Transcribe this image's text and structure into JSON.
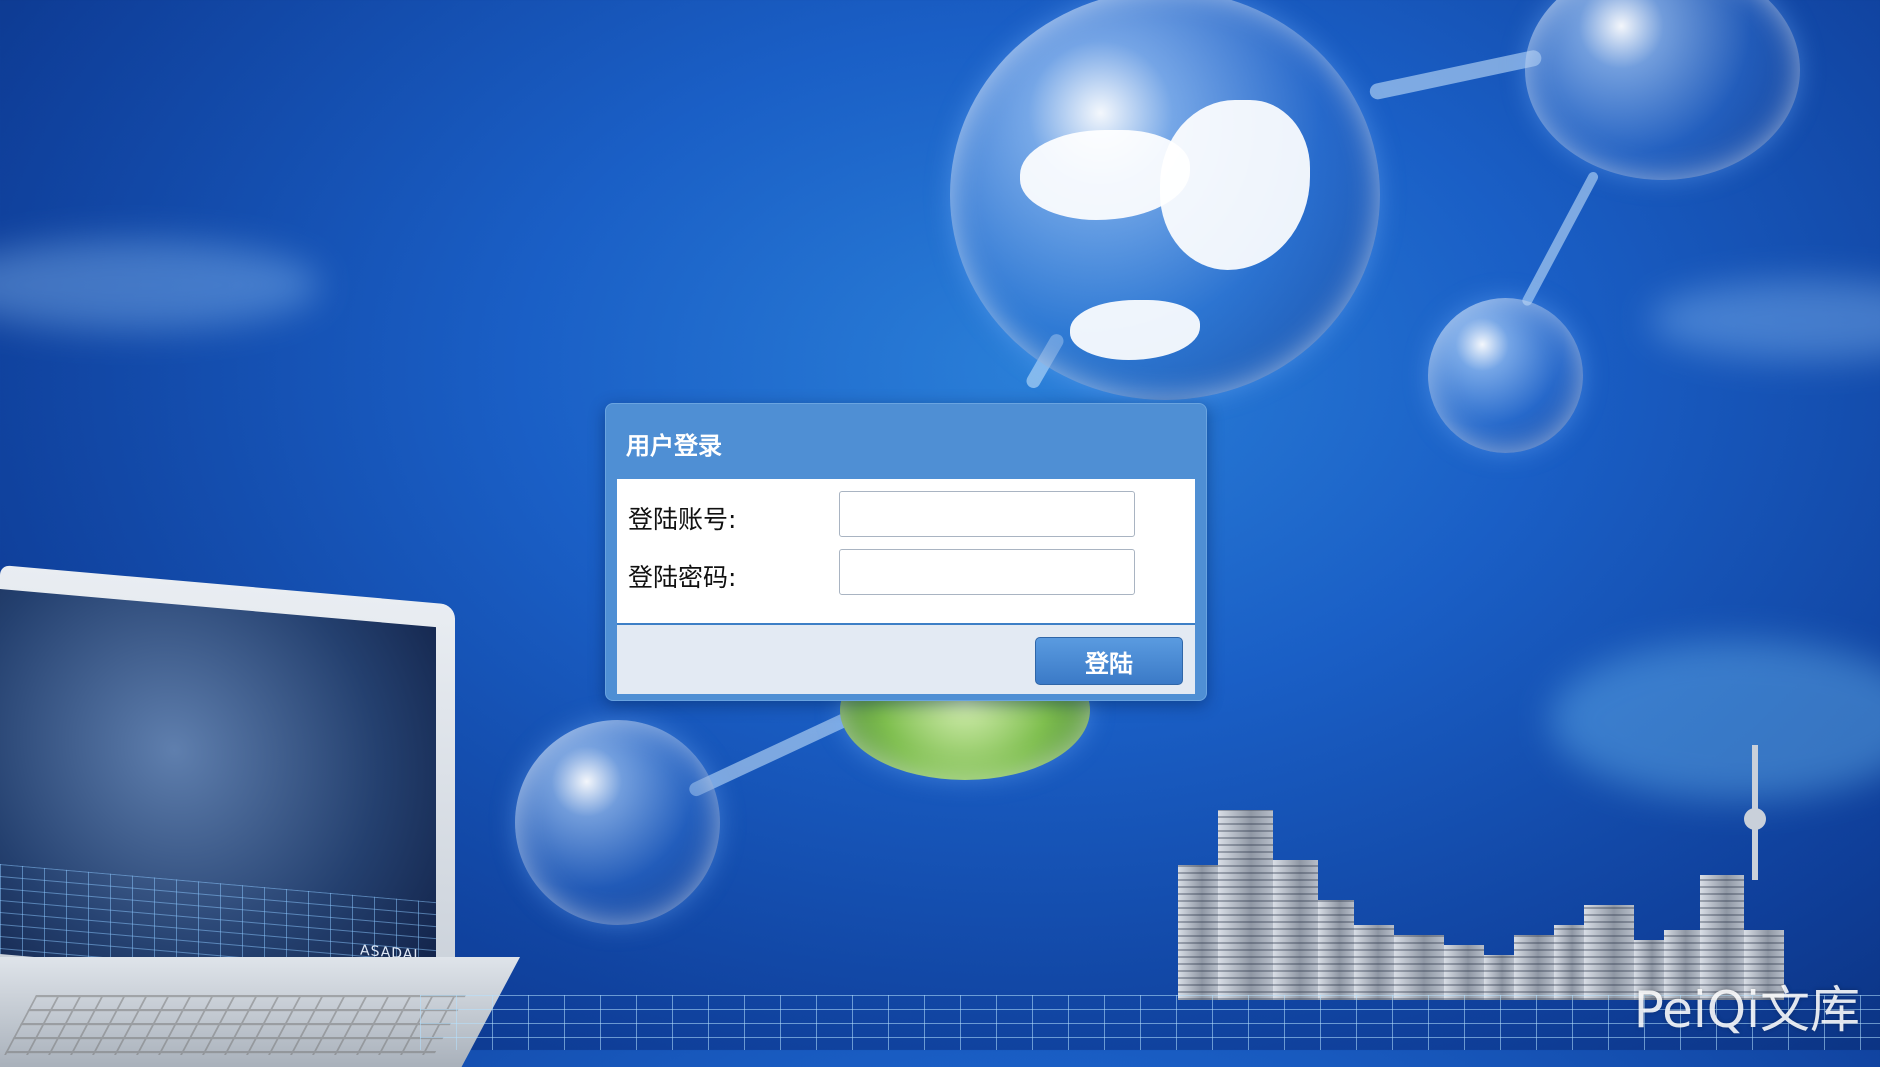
{
  "dialog": {
    "title": "用户登录",
    "account_label": "登陆账号:",
    "account_value": "",
    "password_label": "登陆密码:",
    "password_value": "",
    "login_button_label": "登陆"
  },
  "laptop_screen_brand": "ASADAL",
  "watermark": "PeiQi文库",
  "colors": {
    "background": "#1a5fc6",
    "dialog_header": "#4f8fd4",
    "dialog_footer": "#e3eaf3",
    "button": "#3b7ac7"
  }
}
